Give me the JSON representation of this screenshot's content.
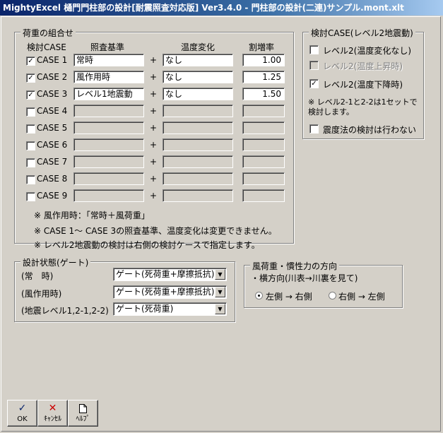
{
  "window": {
    "title": "MightyExcel 樋門門柱部の設計[耐震照査対応版] Ver3.4.0 - 門柱部の設計(二連)サンプル.mont.xlt"
  },
  "load": {
    "group_title": "荷重の組合せ",
    "headers": {
      "case": "検討CASE",
      "basis": "照査基準",
      "temp": "温度変化",
      "rate": "割増率"
    },
    "plus": "+",
    "rows": [
      {
        "label": "CASE 1",
        "checked": true,
        "basis": "常時",
        "temp": "なし",
        "rate": "1.00",
        "enabled": true
      },
      {
        "label": "CASE 2",
        "checked": true,
        "basis": "風作用時",
        "temp": "なし",
        "rate": "1.25",
        "enabled": true
      },
      {
        "label": "CASE 3",
        "checked": true,
        "basis": "レベル1地震動",
        "temp": "なし",
        "rate": "1.50",
        "enabled": true
      },
      {
        "label": "CASE 4",
        "checked": false,
        "basis": "",
        "temp": "",
        "rate": "",
        "enabled": false
      },
      {
        "label": "CASE 5",
        "checked": false,
        "basis": "",
        "temp": "",
        "rate": "",
        "enabled": false
      },
      {
        "label": "CASE 6",
        "checked": false,
        "basis": "",
        "temp": "",
        "rate": "",
        "enabled": false
      },
      {
        "label": "CASE 7",
        "checked": false,
        "basis": "",
        "temp": "",
        "rate": "",
        "enabled": false
      },
      {
        "label": "CASE 8",
        "checked": false,
        "basis": "",
        "temp": "",
        "rate": "",
        "enabled": false
      },
      {
        "label": "CASE 9",
        "checked": false,
        "basis": "",
        "temp": "",
        "rate": "",
        "enabled": false
      }
    ],
    "notes": [
      "※ 風作用時：「常時＋風荷重」",
      "※ CASE 1～ CASE 3の照査基準、温度変化は変更できません。",
      "※ レベル2地震動の検討は右側の検討ケースで指定します。"
    ]
  },
  "level2": {
    "group_title": "検討CASE(レベル2地震動)",
    "opt1": "レベル2(温度変化なし)",
    "opt2": "レベル2(温度上昇時)",
    "opt3": "レベル2(温度下降時)",
    "note1": "※ レベル2-1と2-2は1セットで",
    "note2": "検討します。",
    "opt4": "震度法の検討は行わない",
    "checks": {
      "opt1": false,
      "opt2": false,
      "opt3": true,
      "opt4": false
    }
  },
  "design": {
    "group_title": "設計状態(ゲート)",
    "rows": [
      {
        "label": "(常　時)",
        "value": "ゲート(死荷重+摩擦抵抗)"
      },
      {
        "label": "(風作用時)",
        "value": "ゲート(死荷重+摩擦抵抗)"
      },
      {
        "label": "(地震レベル1,2-1,2-2)",
        "value": "ゲート(死荷重)"
      }
    ]
  },
  "wind": {
    "group_title": "風荷重・慣性力の方向",
    "subtitle": "・横方向(川表→川裏を見て)",
    "opt_left": "左側 → 右側",
    "opt_right": "右側 → 左側",
    "selected": "left"
  },
  "buttons": {
    "ok": "OK",
    "cancel": "ｷｬﾝｾﾙ",
    "help": "ﾍﾙﾌﾟ"
  },
  "icons": {
    "ok": "check-icon",
    "cancel": "x-icon",
    "help": "document-icon"
  },
  "colors": {
    "title_bar": "#0a246a",
    "face": "#d4d0c8",
    "cancel_icon": "#cc0000",
    "ok_icon": "#0a246a"
  }
}
